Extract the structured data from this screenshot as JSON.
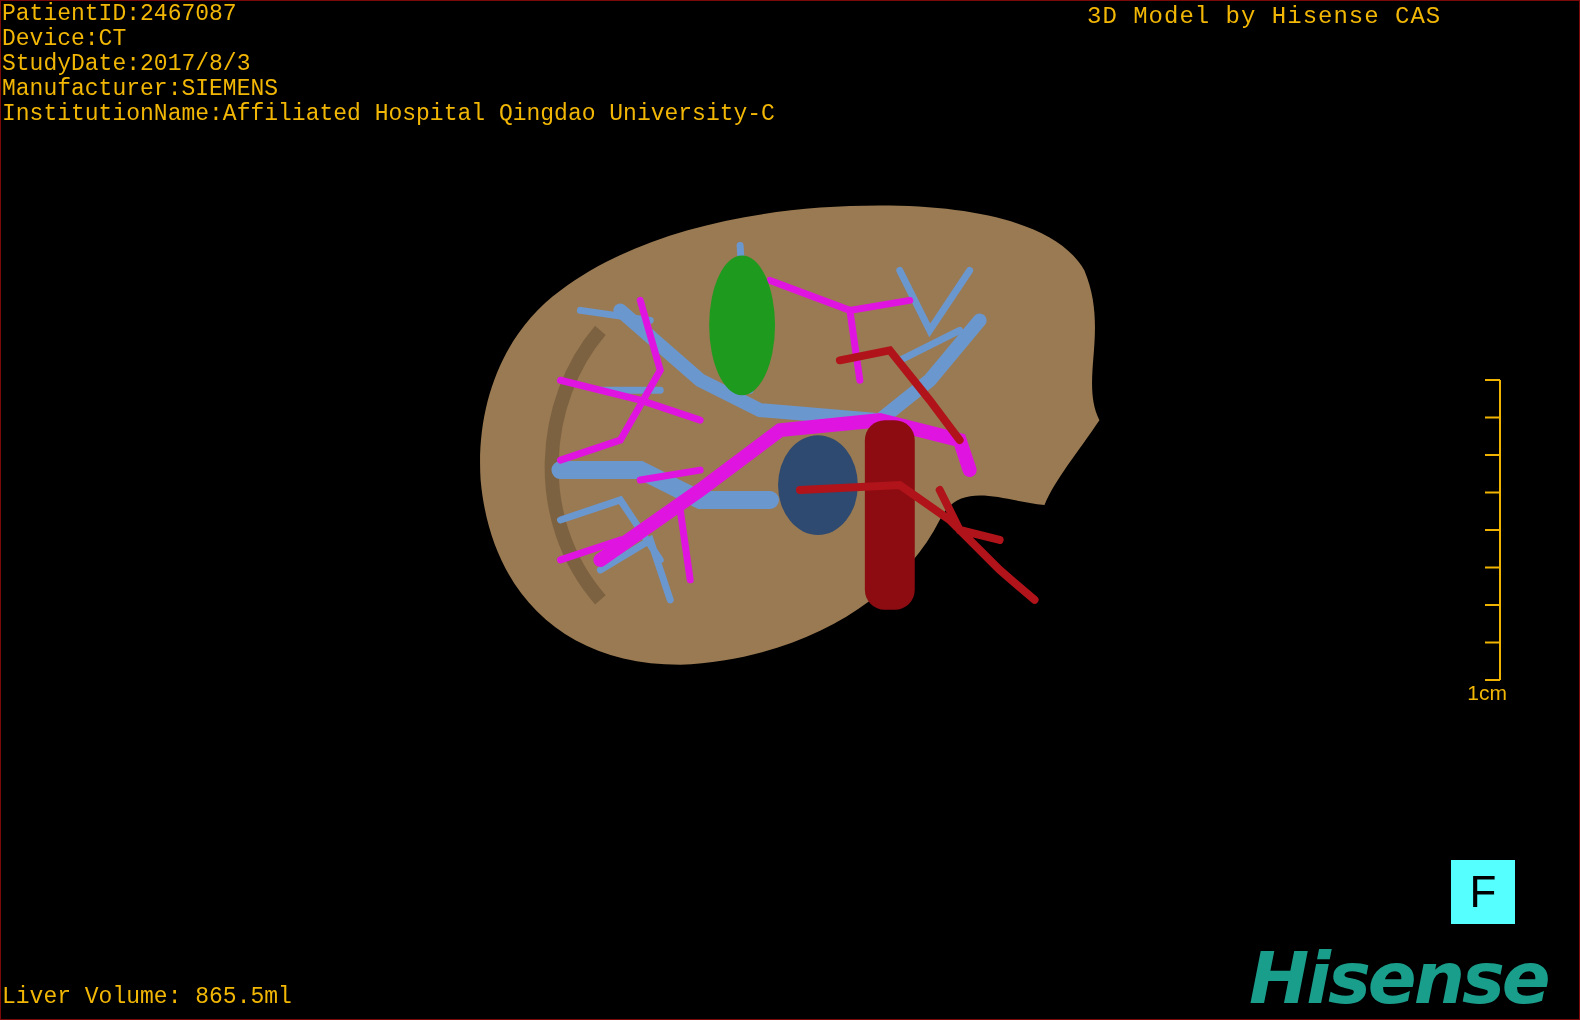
{
  "info_lines": [
    "PatientID:2467087",
    "Device:CT",
    "StudyDate:2017/8/3",
    "Manufacturer:SIEMENS",
    "InstitutionName:Affiliated Hospital Qingdao University-C"
  ],
  "title": "3D Model by Hisense CAS",
  "scale_bar": {
    "label": "1cm"
  },
  "view_button": {
    "label": "F"
  },
  "liver_volume": "Liver Volume: 865.5ml",
  "logo": "Hisense"
}
